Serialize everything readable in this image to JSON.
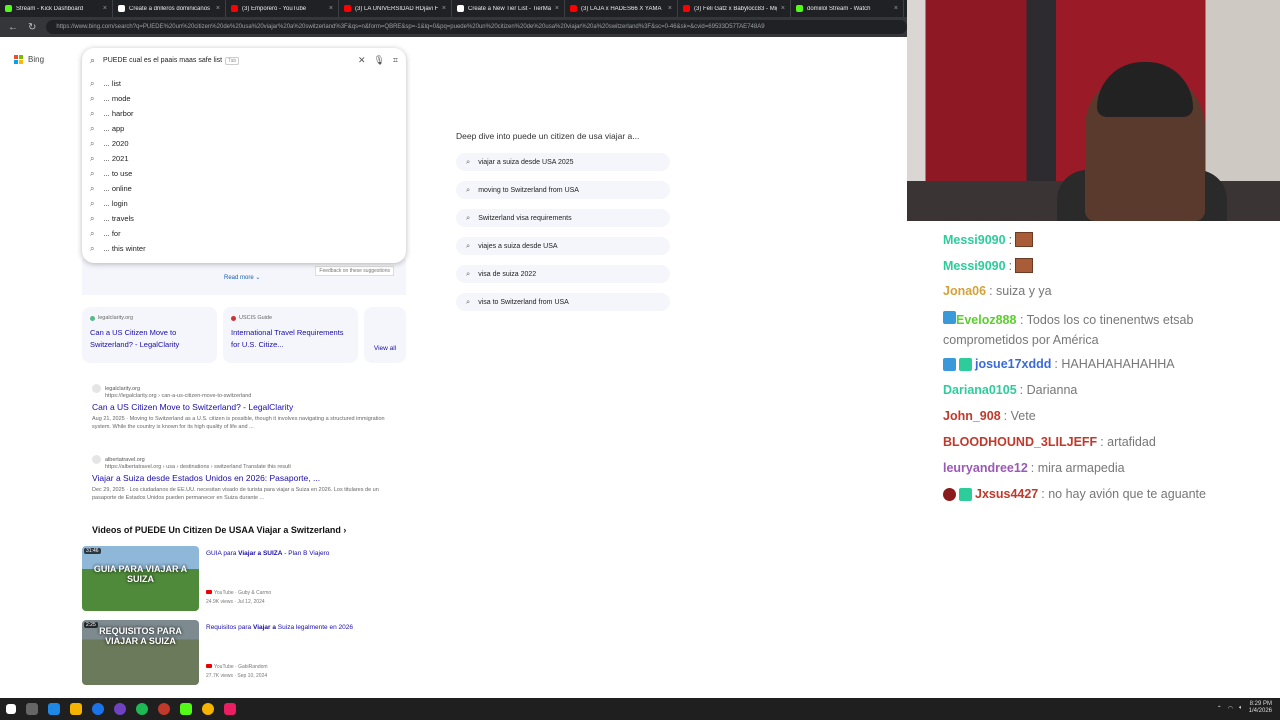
{
  "browser": {
    "tabs": [
      {
        "label": "Stream - Kick Dashboard",
        "color": "#53fc18"
      },
      {
        "label": "Create a drilleros dominicanos",
        "color": "#ffffff"
      },
      {
        "label": "(3) Emporeró - YouTube",
        "color": "#ff0000"
      },
      {
        "label": "(3) LA UNIVERSIDAD RDjavi Fue",
        "color": "#ff0000"
      },
      {
        "label": "Create a New Tier List - TierMak",
        "color": "#ffffff"
      },
      {
        "label": "(3) LAJA x HADES66 X YAMA",
        "color": "#ff0000"
      },
      {
        "label": "(3) Feli Gatz x Babylocc83 - Mig",
        "color": "#ff0000"
      },
      {
        "label": "domiilol Stream - Watch",
        "color": "#53fc18"
      }
    ],
    "url": "https://www.bing.com/search?q=PUEDE%20un%20citizen%20de%20usa%20viajar%20a%20switzerland%3F&qs=n&form=QBRE&sp=-1&lq=0&pq=puede%20un%20citizen%20de%20usa%20viajar%20a%20switzerland%3F&sc=0-46&sk=&cvid=69533D57TAE748A9"
  },
  "bing": {
    "logo_text": "Bing",
    "query": "PUEDE cual es el paais maas safe list",
    "tab_hint": "Tab",
    "suggestions": [
      "... list",
      "... mode",
      "... harbor",
      "... app",
      "... 2020",
      "... 2021",
      "... to use",
      "... online",
      "... login",
      "... travels",
      "... for",
      "... this winter"
    ],
    "read_more": "Read more",
    "feedback": "Feedback on these suggestions",
    "source_cards": [
      {
        "source": "legalclarity.org",
        "title": "Can a US Citizen Move to Switzerland? - LegalClarity"
      },
      {
        "source": "USCIS Guide",
        "title": "International Travel Requirements for U.S. Citize..."
      }
    ],
    "view_all": "View all",
    "results": [
      {
        "site": "legalclarity.org",
        "link": "https://legalclarity.org › can-a-us-citizen-move-to-switzerland",
        "title": "Can a US Citizen Move to Switzerland? - LegalClarity",
        "snippet": "Aug 21, 2025 · Moving to Switzerland as a U.S. citizen is possible, though it involves navigating a structured immigration system. While the country is known for its high quality of life and ..."
      },
      {
        "site": "albertatravel.org",
        "link": "https://albertatravel.org › usa › destinations › switzerland  Translate this result",
        "title": "Viajar a Suiza desde Estados Unidos en 2026: Pasaporte, ...",
        "snippet": "Dec 29, 2025 · Los ciudadanos de EE.UU. necesitan visado de turista para viajar a Suiza en 2026. Los titulares de un pasaporte de Estados Unidos pueden permanecer en Suiza durante ..."
      }
    ],
    "videos_heading": "Videos of PUEDE Un Citizen De USAA Viajar a Switzerland ›",
    "videos": [
      {
        "duration": "31:46",
        "overlay": "GUIA PARA VIAJAR A SUIZA",
        "title_pre": "GUIA para ",
        "title_bold": "Viajar a SUIZA",
        "title_post": " - Plan B Viajero",
        "channel": "YouTube · Guby & Carmo",
        "meta": "24.9K views · Jul 12, 2024",
        "thumb_color": "#4f8a3a"
      },
      {
        "duration": "2:25",
        "overlay": "REQUISITOS PARA VIAJAR A SUIZA",
        "title_pre": "Requisitos para ",
        "title_bold": "Viajar a",
        "title_post": " Suiza legalmente en 2026",
        "channel": "YouTube · GabiRandom",
        "meta": "27.7K views · Sep 10, 2024",
        "thumb_color": "#6b7a5a"
      }
    ],
    "deep_dive": {
      "heading": "Deep dive into puede un citizen de usa viajar a...",
      "items": [
        "viajar a suiza desde USA 2025",
        "moving to Switzerland from USA",
        "Switzerland visa requirements",
        "viajes a suiza desde USA",
        "visa de suiza 2022",
        "visa to Switzerland from USA"
      ]
    }
  },
  "chat": {
    "messages": [
      {
        "user": "Messi9090",
        "user_color": "#2ecc9a",
        "text": "",
        "emote": true,
        "badges": []
      },
      {
        "user": "Messi9090",
        "user_color": "#2ecc9a",
        "text": "",
        "emote": true,
        "badges": []
      },
      {
        "user": "Jona06",
        "user_color": "#d4a23a",
        "text": ": suiza y ya",
        "emote": false,
        "badges": []
      },
      {
        "user": "Eveloz888",
        "user_color": "#5ccf2e",
        "text": ": Todos los co tinenentws etsab comprometidos por América",
        "emote": false,
        "badges": [
          "#3a9ad9"
        ]
      },
      {
        "user": "josue17xddd",
        "user_color": "#3a6ad9",
        "text": ": HAHAHAHAHAHHA",
        "emote": false,
        "badges": [
          "#3a9ad9",
          "#2ecc9a"
        ]
      },
      {
        "user": "Dariana0105",
        "user_color": "#2ecc9a",
        "text": ": Darianna",
        "emote": false,
        "badges": []
      },
      {
        "user": "John_908",
        "user_color": "#c0392b",
        "text": ": Vete",
        "emote": false,
        "badges": []
      },
      {
        "user": "BLOODHOUND_3LILJEFF",
        "user_color": "#c0392b",
        "text": ": artafidad",
        "emote": false,
        "badges": []
      },
      {
        "user": "leuryandree12",
        "user_color": "#9b59b6",
        "text": ": mira armapedia",
        "emote": false,
        "badges": []
      },
      {
        "user": "Jxsus4427",
        "user_color": "#c0392b",
        "text": ": no hay avión que te aguante",
        "emote": false,
        "badges": [
          "round",
          "#2ecc9a"
        ]
      }
    ]
  },
  "taskbar": {
    "time": "8:29 PM",
    "date": "1/4/2026"
  }
}
